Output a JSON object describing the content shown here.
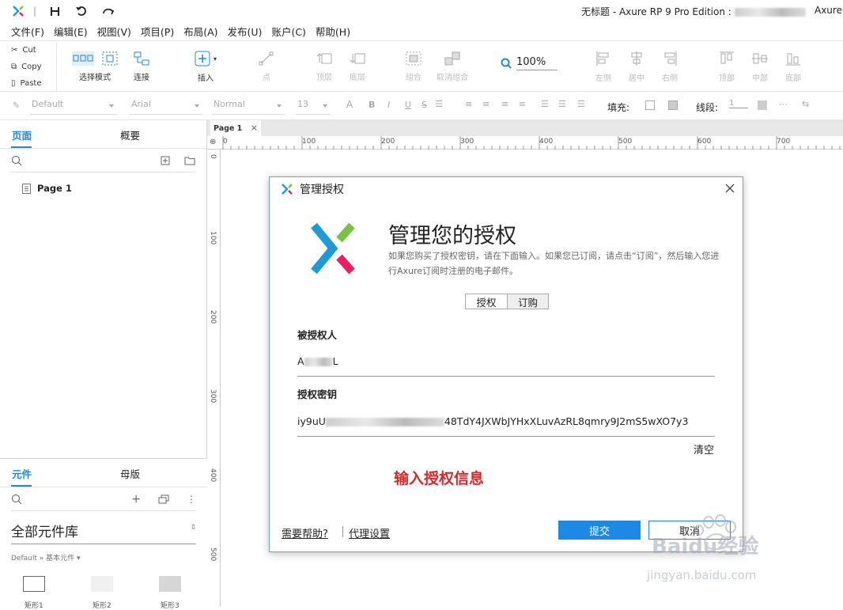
{
  "titlebar": {
    "title": "无标题 - Axure RP 9 Pro Edition : ",
    "right_text": "Axure"
  },
  "menu": [
    "文件(F)",
    "编辑(E)",
    "视图(V)",
    "项目(P)",
    "布局(A)",
    "发布(U)",
    "账户(C)",
    "帮助(H)"
  ],
  "clipboard": {
    "cut": "Cut",
    "copy": "Copy",
    "paste": "Paste"
  },
  "toolbar": {
    "select_mode": "选择模式",
    "connect": "连接",
    "insert": "插入",
    "point": "点",
    "top_layer": "顶层",
    "bottom_layer": "底层",
    "group": "组合",
    "ungroup": "取消组合",
    "zoom": "100%",
    "align_left": "左侧",
    "align_center": "居中",
    "align_right": "右侧",
    "align_top": "顶部",
    "align_middle": "中部",
    "align_bottom": "底部"
  },
  "format": {
    "style": "Default",
    "font": "Arial",
    "weight": "Normal",
    "size": "13",
    "fill_label": "填充:",
    "line_label": "线段:",
    "line_width": "1"
  },
  "pages_panel": {
    "tab_pages": "页面",
    "tab_outline": "概要",
    "page1": "Page 1"
  },
  "library_panel": {
    "tab_widgets": "元件",
    "tab_masters": "母版",
    "library_name": "全部元件库",
    "sub": "Default » 基本元件 ▾",
    "widgets": [
      "矩形1",
      "矩形2",
      "矩形3"
    ]
  },
  "canvas": {
    "doc_tab": "Page 1",
    "ruler_h": [
      "0",
      "100",
      "200",
      "300",
      "400",
      "500",
      "600",
      "700"
    ],
    "ruler_v": [
      "0",
      "100",
      "200",
      "300",
      "400",
      "500"
    ]
  },
  "dialog": {
    "title": "管理授权",
    "heading": "管理您的授权",
    "description": "如果您购买了授权密钥，请在下面输入。如果您已订阅，请点击“订阅”，然后输入您进行Axure订阅时注册的电子邮件。",
    "tab_license": "授权",
    "tab_subscribe": "订购",
    "licensee_label": "被授权人",
    "licensee_value": "A",
    "licensee_tail": "L",
    "key_label": "授权密钥",
    "key_prefix": "iy9uU",
    "key_value": "48TdY4JXWbJYHxXLuvAzRL8qmry9J2mS5wXO7y3",
    "clear": "清空",
    "annotation": "输入授权信息",
    "help_link": "需要帮助?",
    "proxy_link": "代理设置",
    "submit": "提交",
    "cancel": "取消"
  },
  "watermark": {
    "brand": "Baidu经验",
    "url": "jingyan.baidu.com"
  }
}
